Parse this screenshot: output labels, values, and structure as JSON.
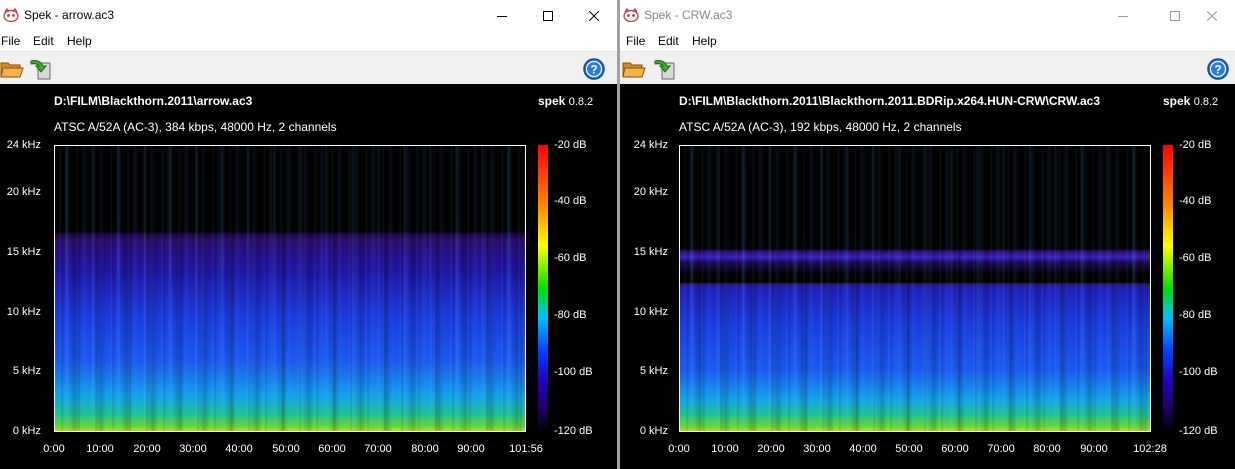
{
  "windows": [
    {
      "title": "Spek - arrow.ac3",
      "menu": [
        "File",
        "Edit",
        "Help"
      ],
      "toolbar": {
        "open_icon": "folder-open-icon",
        "save_icon": "save-arrow-icon",
        "help_icon": "help-icon"
      },
      "filepath": "D:\\FILM\\Blackthorn.2011\\arrow.ac3",
      "brand": "spek",
      "version": "0.8.2",
      "info": "ATSC A/52A (AC-3), 384 kbps, 48000 Hz, 2 channels",
      "y_labels": [
        "24 kHz",
        "20 kHz",
        "15 kHz",
        "10 kHz",
        "5 kHz",
        "0 kHz"
      ],
      "x_labels": [
        "0:00",
        "10:00",
        "20:00",
        "30:00",
        "40:00",
        "50:00",
        "60:00",
        "70:00",
        "80:00",
        "90:00",
        "101:56"
      ],
      "db_labels": [
        "-20 dB",
        "-40 dB",
        "-60 dB",
        "-80 dB",
        "-100 dB",
        "-120 dB"
      ]
    },
    {
      "title": "Spek - CRW.ac3",
      "menu": [
        "File",
        "Edit",
        "Help"
      ],
      "toolbar": {
        "open_icon": "folder-open-icon",
        "save_icon": "save-arrow-icon",
        "help_icon": "help-icon"
      },
      "filepath": "D:\\FILM\\Blackthorn.2011\\Blackthorn.2011.BDRip.x264.HUN-CRW\\CRW.ac3",
      "brand": "spek",
      "version": "0.8.2",
      "info": "ATSC A/52A (AC-3), 192 kbps, 48000 Hz, 2 channels",
      "y_labels": [
        "24 kHz",
        "20 kHz",
        "15 kHz",
        "10 kHz",
        "5 kHz",
        "0 kHz"
      ],
      "x_labels": [
        "0:00",
        "10:00",
        "20:00",
        "30:00",
        "40:00",
        "50:00",
        "60:00",
        "70:00",
        "80:00",
        "90:00",
        "102:28"
      ],
      "db_labels": [
        "-20 dB",
        "-40 dB",
        "-60 dB",
        "-80 dB",
        "-100 dB",
        "-120 dB"
      ]
    }
  ],
  "colors": {
    "background": "#000000",
    "menubar": "#ffffff",
    "toolbar": "#f0f0f0",
    "text": "#ffffff"
  }
}
